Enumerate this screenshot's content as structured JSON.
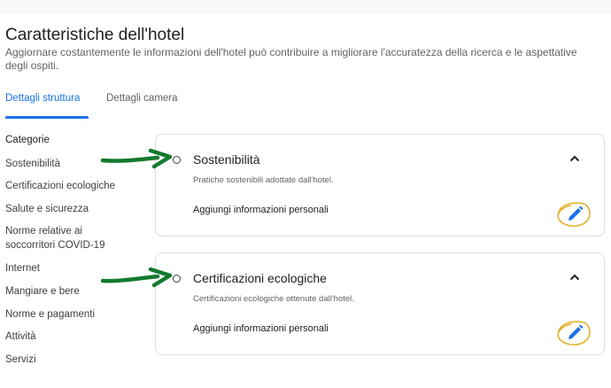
{
  "page": {
    "title": "Caratteristiche dell'hotel",
    "subtitle": "Aggiornare costantemente le informazioni dell'hotel può contribuire a migliorare l'accuratezza della ricerca e le aspettative degli ospiti."
  },
  "tabs": [
    {
      "label": "Dettagli struttura",
      "active": true
    },
    {
      "label": "Dettagli camera",
      "active": false
    }
  ],
  "sidebar": {
    "heading": "Categorie",
    "items": [
      {
        "label": "Sostenibilità"
      },
      {
        "label": "Certificazioni ecologiche"
      },
      {
        "label": "Salute e sicurezza"
      },
      {
        "label": "Norme relative ai soccorritori COVID-19"
      },
      {
        "label": "Internet"
      },
      {
        "label": "Mangiare e bere"
      },
      {
        "label": "Norme e pagamenti"
      },
      {
        "label": "Attività"
      },
      {
        "label": "Servizi"
      }
    ]
  },
  "sections": [
    {
      "title": "Sostenibilità",
      "description": "Pratiche sostenibili adottate dall'hotel.",
      "add_label": "Aggiungi informazioni personali",
      "expanded": true
    },
    {
      "title": "Certificazioni ecologiche",
      "description": "Certificazioni ecologiche ottenute dall'hotel.",
      "add_label": "Aggiungi informazioni personali",
      "expanded": true
    }
  ],
  "icons": {
    "edit": "pencil-icon",
    "collapse": "chevron-up-icon",
    "status": "radio-circle-icon",
    "annotation": "green-arrow-icon"
  },
  "colors": {
    "accent": "#1a73e8",
    "annotation_arrow": "#137a2e",
    "annotation_circle": "#e2b22c"
  }
}
